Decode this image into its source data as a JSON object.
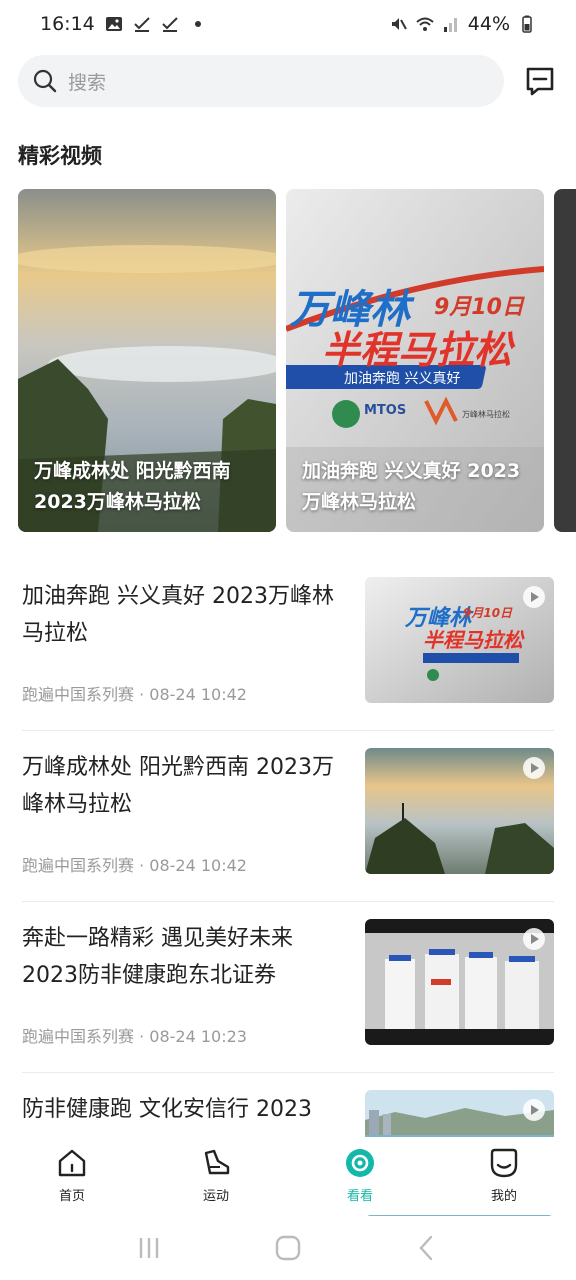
{
  "status_bar": {
    "time": "16:14",
    "battery": "44%"
  },
  "search": {
    "placeholder": "搜索"
  },
  "section": {
    "title": "精彩视频"
  },
  "featured": [
    {
      "caption": "万峰成林处 阳光黔西南 2023万峰林马拉松"
    },
    {
      "caption": "加油奔跑 兴义真好 2023万峰林马拉松"
    },
    {
      "caption": ""
    }
  ],
  "poster": {
    "title_line1": "万峰林",
    "date": "9月10日",
    "title_line2": "半程马拉松",
    "slogan": "加油奔跑 兴义真好",
    "logo_text": "MTOS",
    "partner_text": "万峰林马拉松"
  },
  "list": [
    {
      "title": "加油奔跑 兴义真好 2023万峰林马拉松",
      "meta": "跑遍中国系列赛 · 08-24 10:42"
    },
    {
      "title": "万峰成林处 阳光黔西南  2023万峰林马拉松",
      "meta": "跑遍中国系列赛 · 08-24 10:42"
    },
    {
      "title": "奔赴一路精彩 遇见美好未来 2023防非健康跑东北证券",
      "meta": "跑遍中国系列赛 · 08-24 10:23"
    },
    {
      "title": "防非健康跑 文化安信行 2023",
      "meta": ""
    }
  ],
  "nav": [
    {
      "label": "首页"
    },
    {
      "label": "运动"
    },
    {
      "label": "看看"
    },
    {
      "label": "我的"
    }
  ],
  "colors": {
    "accent": "#13b8a8",
    "text": "#222222",
    "muted": "#9a9a9a"
  }
}
